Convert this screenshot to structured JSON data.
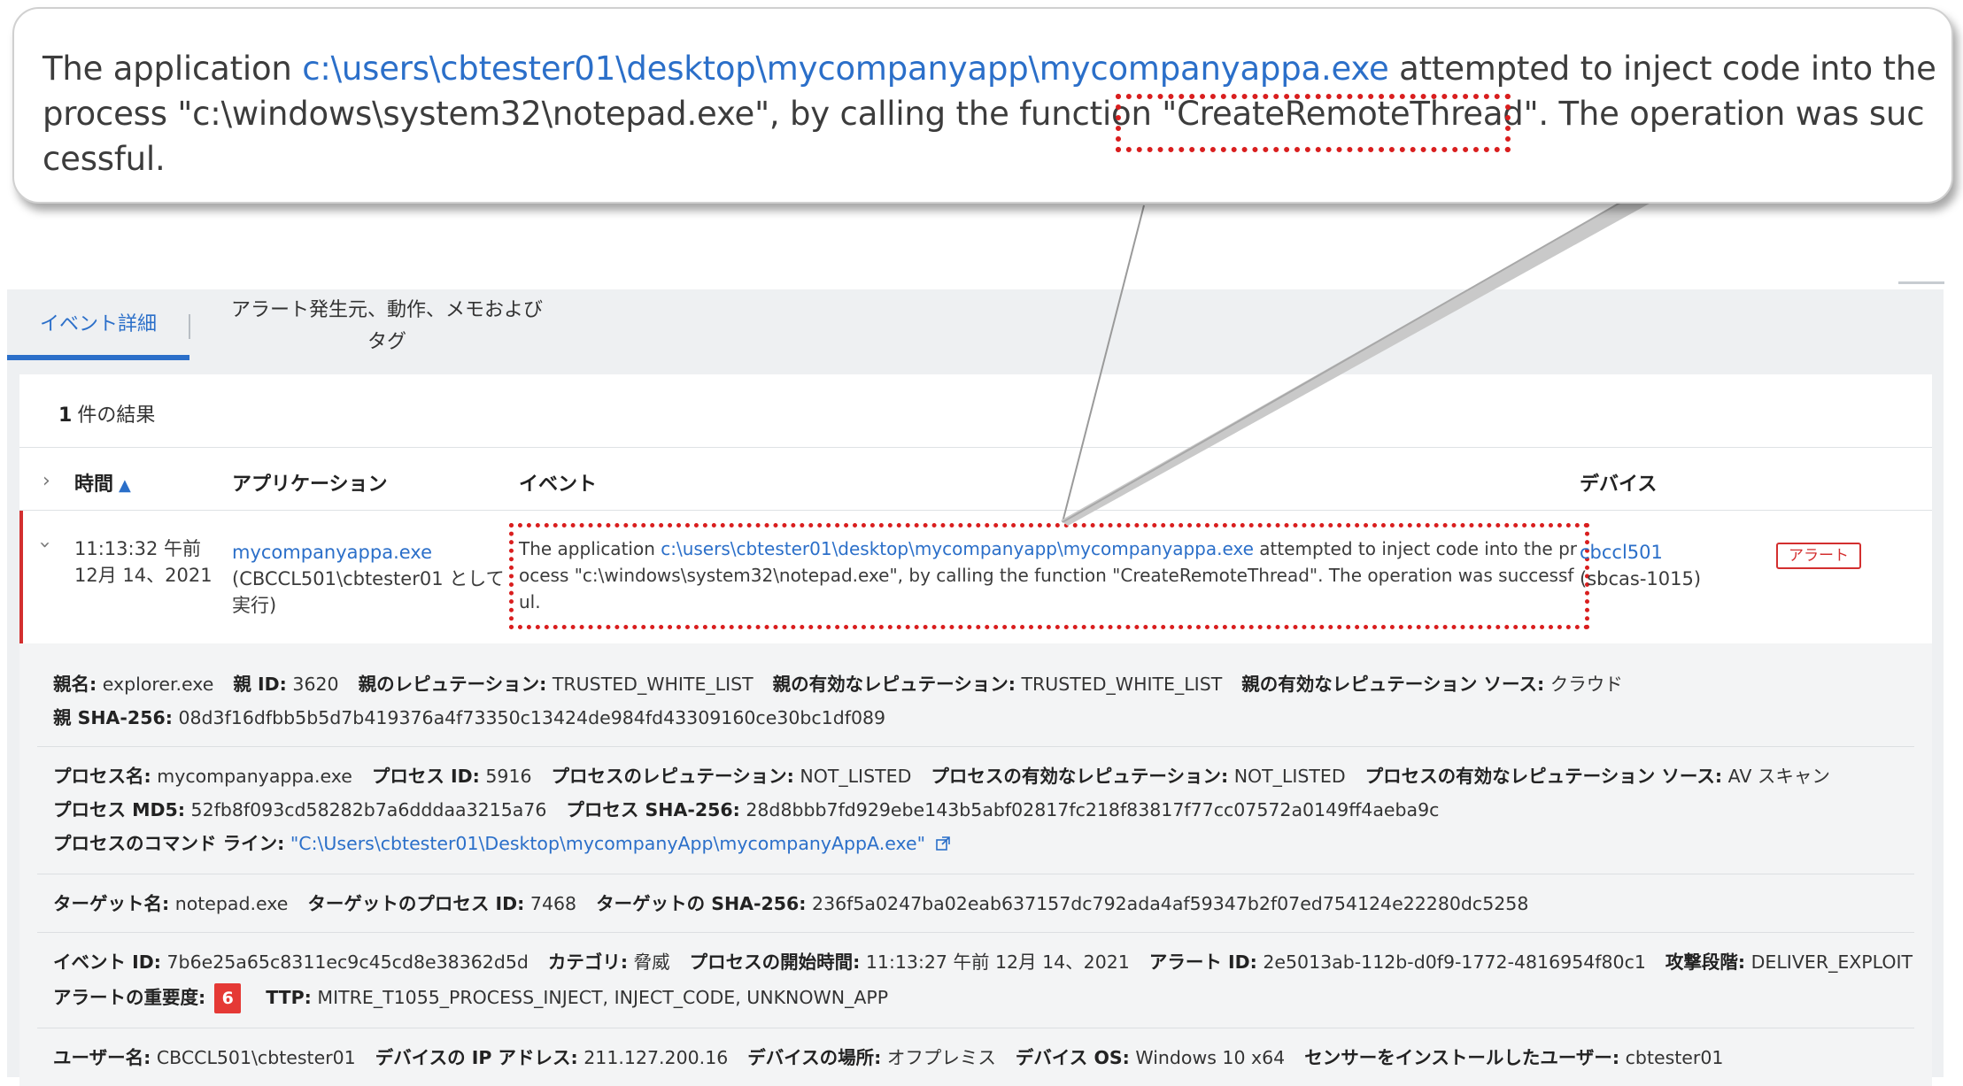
{
  "callout": {
    "text_pre": "The application ",
    "app_path": "c:\\users\\cbtester01\\desktop\\mycompanyapp\\mycompanyappa.exe",
    "text_post": " attempted to inject code into the process \"c:\\windows\\system32\\notepad.exe\", by calling the function \"CreateRemoteThread\". The operation was successful."
  },
  "tabs": {
    "events": "イベント詳細",
    "alert_origin": "アラート発生元、動作、メモおよびタグ"
  },
  "results": {
    "count": "1",
    "label": "件の結果"
  },
  "columns": {
    "time": "時間",
    "application": "アプリケーション",
    "event": "イベント",
    "device": "デバイス"
  },
  "row": {
    "time_line1": "11:13:32 午前",
    "time_line2": "12月 14、2021",
    "app_name": "mycompanyappa.exe",
    "app_run_as": "(CBCCL501\\cbtester01 として実行)",
    "event_pre": "The application ",
    "event_path": "c:\\users\\cbtester01\\desktop\\mycompanyapp\\mycompanyappa.exe",
    "event_post": " attempted to inject code into the process \"c:\\windows\\system32\\notepad.exe\", by calling the function \"CreateRemoteThread\". The operation was successful.",
    "device_name": "cbccl501",
    "device_sub": "(sbcas-1015)",
    "badge": "アラート"
  },
  "details": {
    "parent_name_label": "親名:",
    "parent_name": "explorer.exe",
    "parent_id_label": "親 ID:",
    "parent_id": "3620",
    "parent_rep_label": "親のレピュテーション:",
    "parent_rep": "TRUSTED_WHITE_LIST",
    "parent_eff_rep_label": "親の有効なレピュテーション:",
    "parent_eff_rep": "TRUSTED_WHITE_LIST",
    "parent_eff_rep_src_label": "親の有効なレピュテーション ソース:",
    "parent_eff_rep_src": "クラウド",
    "parent_sha_label": "親 SHA-256:",
    "parent_sha": "08d3f16dfbb5b5d7b419376a4f73350c13424de984fd43309160ce30bc1df089",
    "proc_name_label": "プロセス名:",
    "proc_name": "mycompanyappa.exe",
    "proc_id_label": "プロセス ID:",
    "proc_id": "5916",
    "proc_rep_label": "プロセスのレピュテーション:",
    "proc_rep": "NOT_LISTED",
    "proc_eff_rep_label": "プロセスの有効なレピュテーション:",
    "proc_eff_rep": "NOT_LISTED",
    "proc_eff_rep_src_label": "プロセスの有効なレピュテーション ソース:",
    "proc_eff_rep_src": "AV スキャン",
    "proc_md5_label": "プロセス MD5:",
    "proc_md5": "52fb8f093cd58282b7a6dddaa3215a76",
    "proc_sha_label": "プロセス SHA-256:",
    "proc_sha": "28d8bbb7fd929ebe143b5abf02817fc218f83817f77cc07572a0149ff4aeba9c",
    "proc_cmd_label": "プロセスのコマンド ライン:",
    "proc_cmd": "\"C:\\Users\\cbtester01\\Desktop\\mycompanyApp\\mycompanyAppA.exe\"",
    "target_name_label": "ターゲット名:",
    "target_name": "notepad.exe",
    "target_pid_label": "ターゲットのプロセス ID:",
    "target_pid": "7468",
    "target_sha_label": "ターゲットの SHA-256:",
    "target_sha": "236f5a0247ba02eab637157dc792ada4af59347b2f07ed754124e22280dc5258",
    "event_id_label": "イベント ID:",
    "event_id": "7b6e25a65c8311ec9c45cd8e38362d5d",
    "category_label": "カテゴリ:",
    "category": "脅威",
    "proc_start_label": "プロセスの開始時間:",
    "proc_start": "11:13:27 午前 12月 14、2021",
    "alert_id_label": "アラート ID:",
    "alert_id": "2e5013ab-112b-d0f9-1772-4816954f80c1",
    "attack_stage_label": "攻撃段階:",
    "attack_stage": "DELIVER_EXPLOIT",
    "severity_label": "アラートの重要度:",
    "severity": "6",
    "ttp_label": "TTP:",
    "ttp": "MITRE_T1055_PROCESS_INJECT, INJECT_CODE, UNKNOWN_APP",
    "user_label": "ユーザー名:",
    "user": "CBCCL501\\cbtester01",
    "ip_label": "デバイスの IP アドレス:",
    "ip": "211.127.200.16",
    "location_label": "デバイスの場所:",
    "location": "オフプレミス",
    "os_label": "デバイス OS:",
    "os": "Windows 10 x64",
    "installer_label": "センサーをインストールしたユーザー:",
    "installer": "cbtester01"
  },
  "colors": {
    "accent_blue": "#2b6fc9",
    "alert_red": "#d32f2f",
    "highlight_red": "#d91e1e"
  }
}
